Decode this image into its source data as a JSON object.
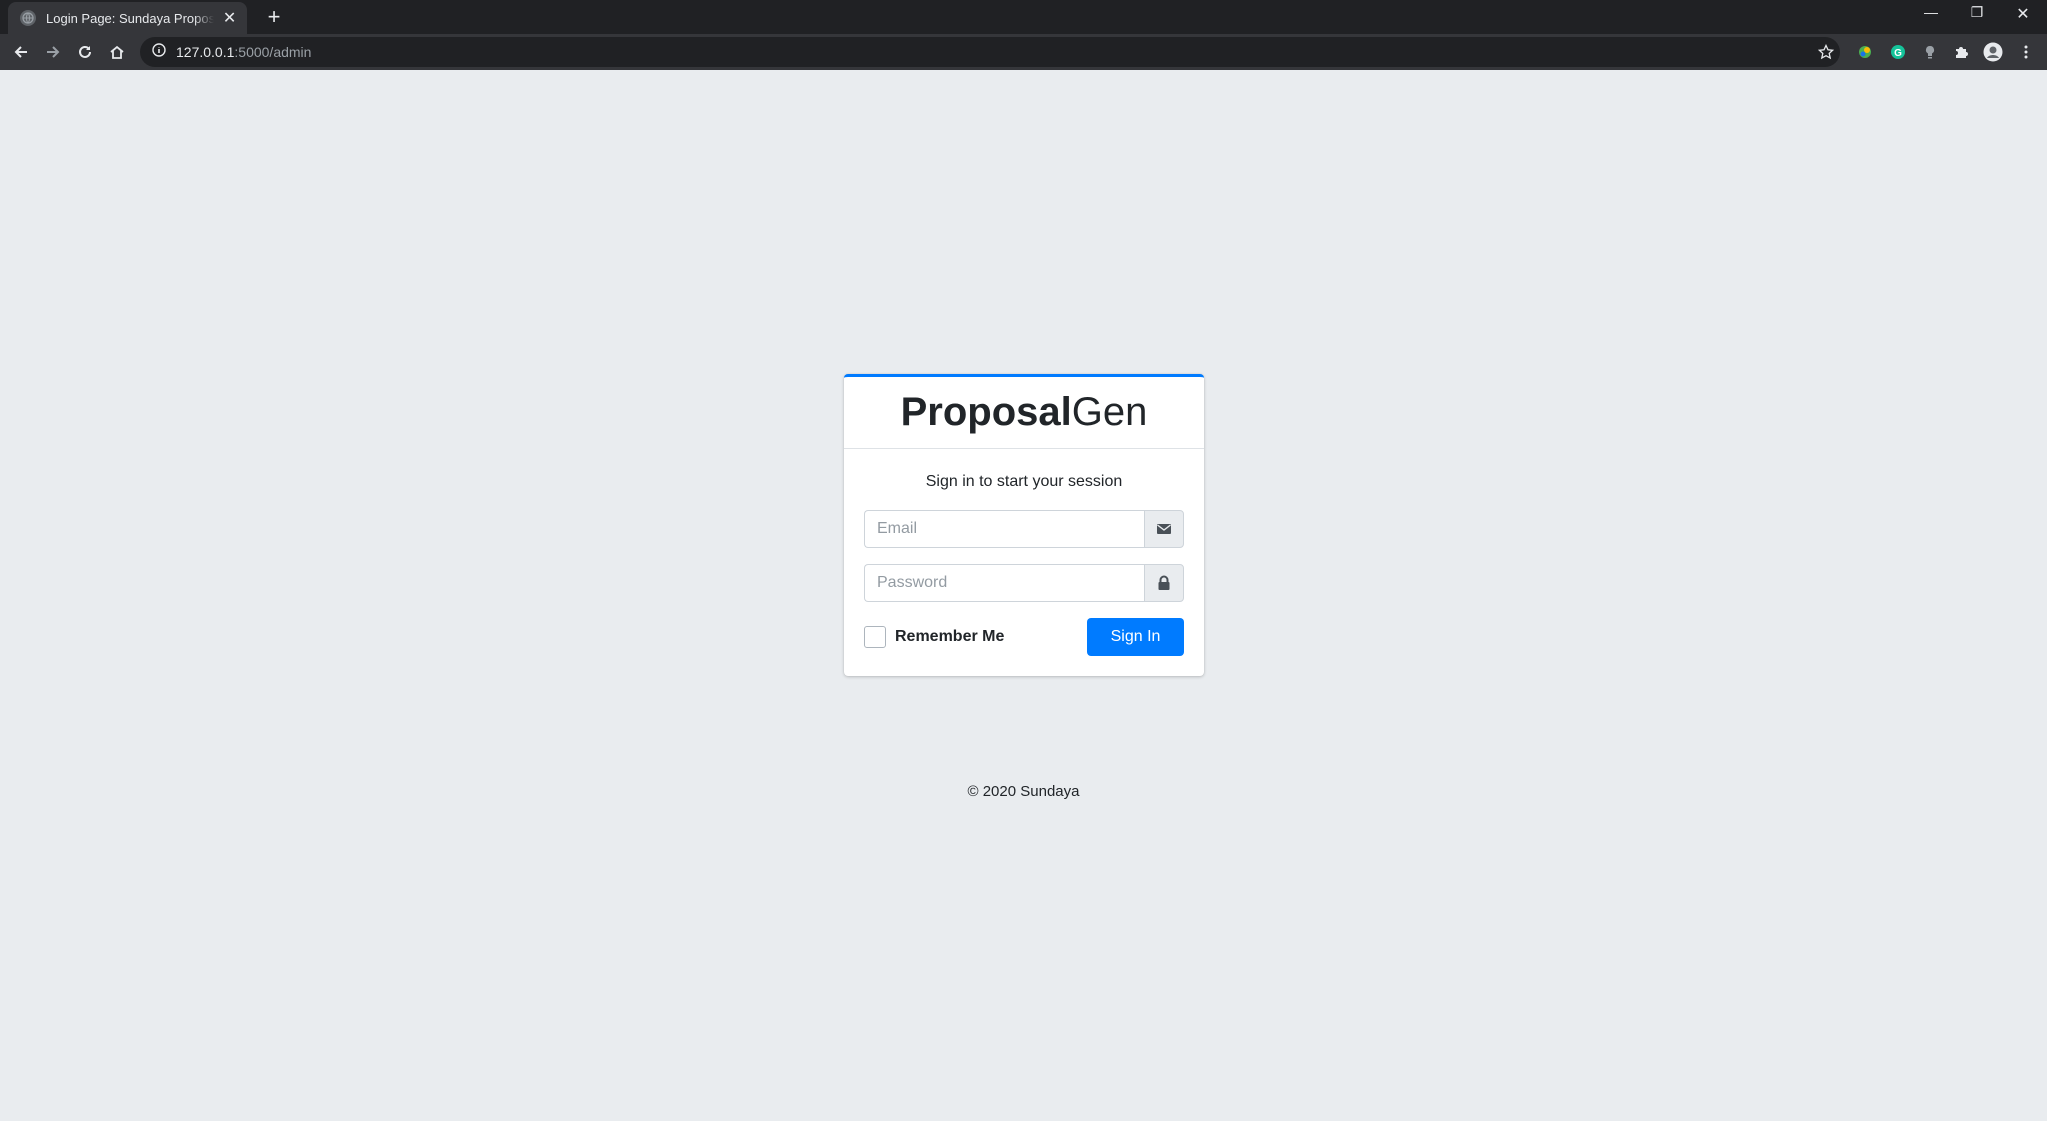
{
  "browser": {
    "tab_title": "Login Page: Sundaya Proposal Gen",
    "new_tab": "+",
    "tab_close": "✕",
    "url_host": "127.0.0.1",
    "url_path": ":5000/admin",
    "window": {
      "minimize": "—",
      "restore": "❐",
      "close": "✕"
    }
  },
  "login": {
    "brand_bold": "Proposal",
    "brand_light": "Gen",
    "message": "Sign in to start your session",
    "email_placeholder": "Email",
    "password_placeholder": "Password",
    "remember_label": "Remember Me",
    "signin_label": "Sign In",
    "accent_color": "#007bff"
  },
  "footer": {
    "text": "© 2020 Sundaya"
  }
}
